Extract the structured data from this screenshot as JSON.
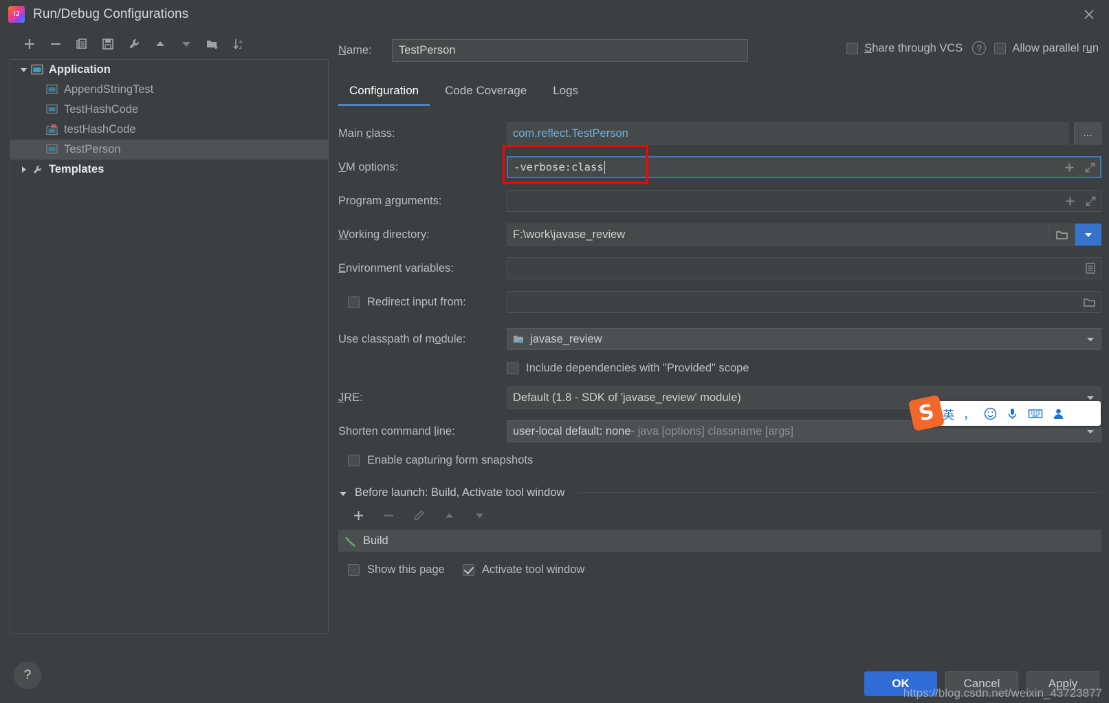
{
  "window": {
    "title": "Run/Debug Configurations",
    "logo_icon": "intellij-idea-logo",
    "close_icon": "close-icon"
  },
  "sidebar": {
    "toolbar": [
      {
        "name": "add-configuration-button",
        "icon": "plus-icon"
      },
      {
        "name": "remove-configuration-button",
        "icon": "minus-icon"
      },
      {
        "name": "copy-configuration-button",
        "icon": "copy-icon"
      },
      {
        "name": "save-configuration-button",
        "icon": "save-icon"
      },
      {
        "name": "edit-templates-button",
        "icon": "wrench-icon"
      },
      {
        "name": "move-up-button",
        "icon": "arrow-up-icon"
      },
      {
        "name": "move-down-button",
        "icon": "arrow-down-icon"
      },
      {
        "name": "new-folder-button",
        "icon": "folder-add-icon"
      },
      {
        "name": "sort-configurations-button",
        "icon": "sort-az-icon"
      }
    ],
    "tree": [
      {
        "label": "Application",
        "icon": "application-icon",
        "type": "group",
        "expanded": true,
        "arrow": "triangle-down"
      },
      {
        "label": "AppendStringTest",
        "icon": "application-icon",
        "type": "item",
        "error": false
      },
      {
        "label": "TestHashCode",
        "icon": "application-icon",
        "type": "item",
        "error": false
      },
      {
        "label": "testHashCode",
        "icon": "application-error-icon",
        "type": "item",
        "error": true
      },
      {
        "label": "TestPerson",
        "icon": "application-icon",
        "type": "item",
        "error": false,
        "selected": true
      },
      {
        "label": "Templates",
        "icon": "wrench-icon",
        "type": "group",
        "expanded": false,
        "arrow": "triangle-right"
      }
    ]
  },
  "header": {
    "name_label": "Name:",
    "name_value": "TestPerson",
    "share_vcs_label": "Share through VCS",
    "share_vcs_checked": false,
    "help_icon": "question-mark-icon",
    "parallel_run_label": "Allow parallel run",
    "parallel_run_checked": false
  },
  "tabs": [
    {
      "label": "Configuration",
      "active": true
    },
    {
      "label": "Code Coverage",
      "active": false
    },
    {
      "label": "Logs",
      "active": false
    }
  ],
  "form": {
    "main_class": {
      "label": "Main class:",
      "value": "com.reflect.TestPerson",
      "browse_label": "..."
    },
    "vm_options": {
      "label": "VM options:",
      "value": "-verbose:class",
      "focused": true,
      "highlighted": true,
      "expand_icon": "expand-icon",
      "macro_icon": "plus-icon"
    },
    "program_arguments": {
      "label": "Program arguments:",
      "value": "",
      "expand_icon": "expand-icon",
      "macro_icon": "plus-icon"
    },
    "working_directory": {
      "label": "Working directory:",
      "value": "F:\\work\\javase_review",
      "browse_icon": "folder-icon",
      "dropdown_icon": "chevron-down-icon"
    },
    "environment_variables": {
      "label": "Environment variables:",
      "value": "",
      "editor_icon": "list-editor-icon"
    },
    "redirect_input": {
      "label": "Redirect input from:",
      "checked": false,
      "value": "",
      "browse_icon": "folder-icon"
    },
    "classpath_module": {
      "label": "Use classpath of module:",
      "value": "javase_review",
      "module_icon": "module-icon",
      "dropdown_icon": "chevron-down-icon"
    },
    "include_provided": {
      "label": "Include dependencies with \"Provided\" scope",
      "checked": false
    },
    "jre": {
      "label": "JRE:",
      "value": "Default (1.8 - SDK of 'javase_review' module)",
      "dropdown_icon": "chevron-down-icon"
    },
    "shorten_command_line": {
      "label": "Shorten command line:",
      "value": "user-local default: none",
      "value_hint": " - java [options] classname [args]",
      "dropdown_icon": "chevron-down-icon"
    },
    "form_snapshots": {
      "label": "Enable capturing form snapshots",
      "checked": false
    }
  },
  "before_launch": {
    "title": "Before launch: Build, Activate tool window",
    "collapse_icon": "triangle-down-icon",
    "toolbar": [
      {
        "name": "add-task-button",
        "icon": "plus-icon",
        "enabled": true
      },
      {
        "name": "remove-task-button",
        "icon": "minus-icon",
        "enabled": false
      },
      {
        "name": "edit-task-button",
        "icon": "pencil-icon",
        "enabled": false
      },
      {
        "name": "move-task-up-button",
        "icon": "arrow-up-icon",
        "enabled": false
      },
      {
        "name": "move-task-down-button",
        "icon": "arrow-down-icon",
        "enabled": false
      }
    ],
    "tasks": [
      {
        "label": "Build",
        "icon": "build-hammer-icon"
      }
    ],
    "show_page_label": "Show this page",
    "show_page_checked": false,
    "activate_tool_window_label": "Activate tool window",
    "activate_tool_window_checked": true
  },
  "footer": {
    "help_label": "?",
    "ok_label": "OK",
    "cancel_label": "Cancel",
    "apply_label": "Apply"
  },
  "watermark": {
    "text": "https://blog.csdn.net/weixin_43723877"
  },
  "ime_bar": {
    "logo_text": "S",
    "items": [
      {
        "label": "英",
        "name": "ime-language-toggle"
      },
      {
        "label": "，",
        "name": "ime-punctuation-toggle"
      },
      {
        "label": "☺",
        "name": "ime-emoji-button"
      },
      {
        "label": "🎤",
        "name": "ime-voice-input-button"
      },
      {
        "label": "⌨",
        "name": "ime-keyboard-button"
      },
      {
        "label": "👤",
        "name": "ime-user-button"
      }
    ]
  },
  "colors": {
    "accent": "#3573cc",
    "highlight": "#ff0000",
    "link": "#6eb3e0",
    "tab_underline": "#4d84c8",
    "build_icon": "#54b15b"
  }
}
